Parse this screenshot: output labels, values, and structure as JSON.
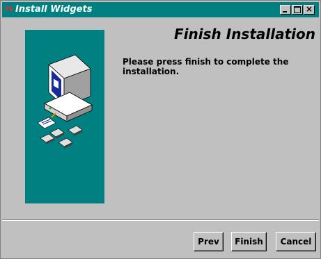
{
  "window": {
    "title": "Install Widgets",
    "title_icon": "tk-feather-icon",
    "controls": [
      "minimize-icon",
      "maximize-icon",
      "close-icon"
    ]
  },
  "main": {
    "heading": "Finish Installation",
    "message": "Please press finish to complete the installation."
  },
  "buttons": {
    "prev": "Prev",
    "finish": "Finish",
    "cancel": "Cancel"
  },
  "colors": {
    "titlebar": "#008080",
    "panel": "#008080",
    "face": "#c0c0c0"
  }
}
